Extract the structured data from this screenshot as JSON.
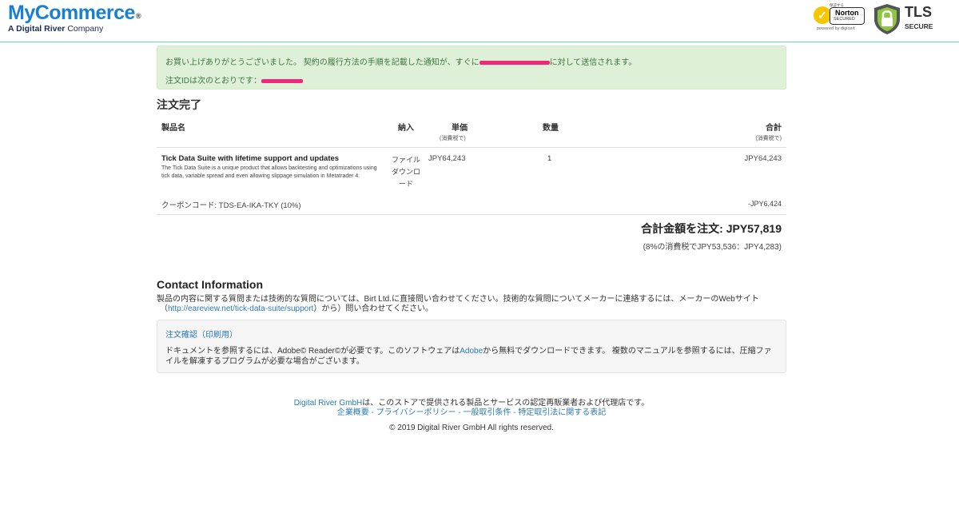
{
  "header": {
    "logo_main": "MyCommerce",
    "logo_reg": "®",
    "logo_sub_a": "A Digital River",
    "logo_sub_b": "Company",
    "norton_top": "保証する",
    "norton_name": "Norton",
    "norton_secured": "SECURED",
    "norton_powered": "powered by digicert",
    "tls_title": "TLS",
    "tls_sub": "SECURE"
  },
  "notice": {
    "line1_before": "お買い上げありがとうございました。 契約の履行方法の手順を記載した通知が、すぐに",
    "line1_after": "に対して送信されます。",
    "line2": "注文IDは次のとおりです："
  },
  "order": {
    "heading": "注文完了",
    "columns": {
      "product": "製品名",
      "delivery": "納入",
      "unit_price": "単価",
      "unit_price_sub": "(消費税で)",
      "quantity": "数量",
      "total": "合計",
      "total_sub": "(消費税で)"
    },
    "item": {
      "name": "Tick Data Suite with lifetime support and updates",
      "description": "The Tick Data Suite is a unique product that allows backtesting and optimizations using tick data, variable spread and even allowing slippage simulation in Metatrader 4.",
      "delivery": "ファイルダウンロード",
      "unit_price": "JPY64,243",
      "quantity": "1",
      "total": "JPY64,243"
    },
    "coupon_label": "クーポンコード: TDS-EA-IKA-TKY (10%)",
    "coupon_amount": "-JPY6,424",
    "grand_total": "合計金額を注文:  JPY57,819",
    "tax_note": "(8%の消費税でJPY53,536：JPY4,283)"
  },
  "contact": {
    "heading": "Contact Information",
    "text_before": "製品の内容に関する質問または技術的な質問については、Birt Ltd.に直接問い合わせてください。技術的な質問についてメーカーに連絡するには、メーカーのWebサイト",
    "paren_open": "（",
    "url": "http://eareview.net/tick-data-suite/support",
    "text_after": "）から）問い合わせてください。"
  },
  "print": {
    "link": "注文確認（印刷用）",
    "text_before": "ドキュメントを参照するには、Adobe© Reader©が必要です。このソフトウェアは",
    "adobe_link": "Adobe",
    "text_after": "から無料でダウンロードできます。 複数のマニュアルを参照するには、圧縮ファイルを解凍するプログラムが必要な場合がございます。"
  },
  "footer": {
    "dr_link": "Digital River GmbH",
    "dr_text": "は、このストアで提供される製品とサービスの認定再販業者および代理店です。",
    "links": [
      "企業概要",
      "プライバシーポリシー",
      "一般取引条件",
      "特定取引法に関する表記"
    ],
    "separator": " - ",
    "copyright": "© 2019 Digital River GmbH All rights reserved."
  }
}
